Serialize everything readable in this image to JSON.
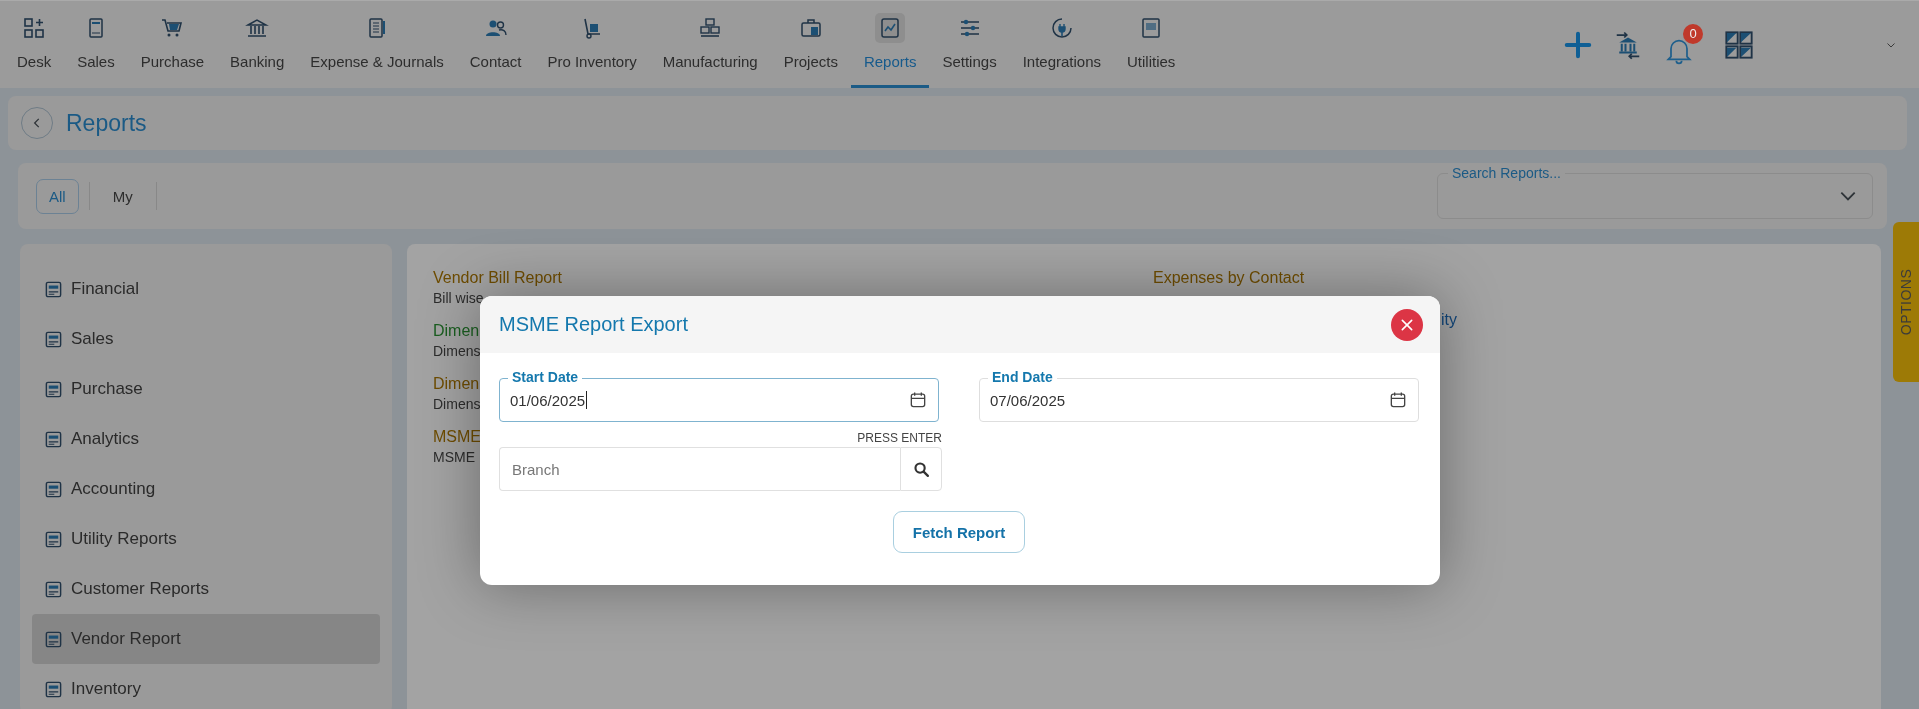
{
  "top_nav": {
    "items": [
      {
        "label": "Desk",
        "selected": false
      },
      {
        "label": "Sales",
        "selected": false
      },
      {
        "label": "Purchase",
        "selected": false
      },
      {
        "label": "Banking",
        "selected": false
      },
      {
        "label": "Expense & Journals",
        "selected": false
      },
      {
        "label": "Contact",
        "selected": false
      },
      {
        "label": "Pro Inventory",
        "selected": false
      },
      {
        "label": "Manufacturing",
        "selected": false
      },
      {
        "label": "Projects",
        "selected": false
      },
      {
        "label": "Reports",
        "selected": true
      },
      {
        "label": "Settings",
        "selected": false
      },
      {
        "label": "Integrations",
        "selected": false
      },
      {
        "label": "Utilities",
        "selected": false
      }
    ],
    "notification_count": "0"
  },
  "page_header": {
    "title": "Reports"
  },
  "filter_tabs": [
    {
      "label": "All",
      "selected": true
    },
    {
      "label": "My",
      "selected": false
    }
  ],
  "search": {
    "label": "Search Reports..."
  },
  "sidebar": {
    "items": [
      {
        "label": "Financial",
        "selected": false
      },
      {
        "label": "Sales",
        "selected": false
      },
      {
        "label": "Purchase",
        "selected": false
      },
      {
        "label": "Analytics",
        "selected": false
      },
      {
        "label": "Accounting",
        "selected": false
      },
      {
        "label": "Utility Reports",
        "selected": false
      },
      {
        "label": "Customer Reports",
        "selected": false
      },
      {
        "label": "Vendor Report",
        "selected": true
      },
      {
        "label": "Inventory",
        "selected": false
      }
    ]
  },
  "report_columns": [
    [
      {
        "title": "Vendor Bill Report",
        "description": "Bill wise",
        "color": "#6e4c00"
      },
      {
        "title": "Dimen",
        "description": "Dimens",
        "color": "#1a5e20"
      },
      {
        "title": "Dimen",
        "description": "Dimens",
        "color": "#6e4c00"
      },
      {
        "title": "MSME",
        "description": "MSME",
        "color": "#6e4c00"
      }
    ],
    [
      {
        "title": "Expenses by Contact",
        "color": "#6e4c00"
      },
      {
        "title": "ity",
        "color": "#12467a"
      }
    ]
  ],
  "options_tab": {
    "label": "OPTIONS"
  },
  "modal": {
    "title": "MSME Report Export",
    "date_fields": [
      {
        "label": "Start Date",
        "value": "01/06/2025",
        "focused": true
      },
      {
        "label": "End Date",
        "value": "07/06/2025",
        "focused": false
      }
    ],
    "branch": {
      "placeholder": "Branch",
      "hint": "PRESS ENTER"
    },
    "button": "Fetch Report"
  }
}
